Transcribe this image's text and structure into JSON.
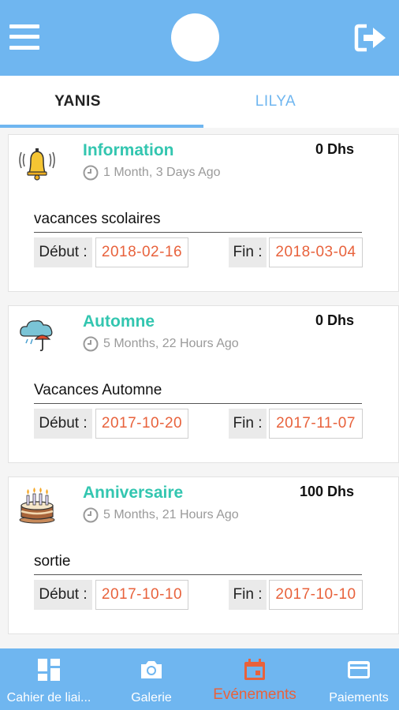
{
  "header": {
    "menu_icon": "menu-icon",
    "logout_icon": "logout-icon"
  },
  "tabs": [
    {
      "label": "YANIS",
      "active": true
    },
    {
      "label": "LILYA",
      "active": false
    }
  ],
  "events": [
    {
      "icon": "bell-icon",
      "title": "Information",
      "time": "1 Month, 3 Days Ago",
      "amount": "0 Dhs",
      "description": "vacances scolaires",
      "start_label": "Début :",
      "start": "2018-02-16",
      "end_label": "Fin :",
      "end": "2018-03-04"
    },
    {
      "icon": "umbrella-cloud-icon",
      "title": "Automne",
      "time": "5 Months, 22 Hours Ago",
      "amount": "0 Dhs",
      "description": "Vacances Automne",
      "start_label": "Début :",
      "start": "2017-10-20",
      "end_label": "Fin :",
      "end": "2017-11-07"
    },
    {
      "icon": "birthday-cake-icon",
      "title": "Anniversaire",
      "time": "5 Months, 21 Hours Ago",
      "amount": "100 Dhs",
      "description": "sortie",
      "start_label": "Début :",
      "start": "2017-10-10",
      "end_label": "Fin :",
      "end": "2017-10-10"
    }
  ],
  "bottom_nav": [
    {
      "label": "Cahier de liai...",
      "icon": "dashboard-icon"
    },
    {
      "label": "Galerie",
      "icon": "camera-icon"
    },
    {
      "label": "Evénements",
      "icon": "calendar-icon",
      "active": true
    },
    {
      "label": "Paiements",
      "icon": "credit-card-icon"
    }
  ],
  "colors": {
    "primary": "#6fb6f0",
    "title": "#33c6b0",
    "date": "#e8623c",
    "active_nav": "#e8623c"
  }
}
